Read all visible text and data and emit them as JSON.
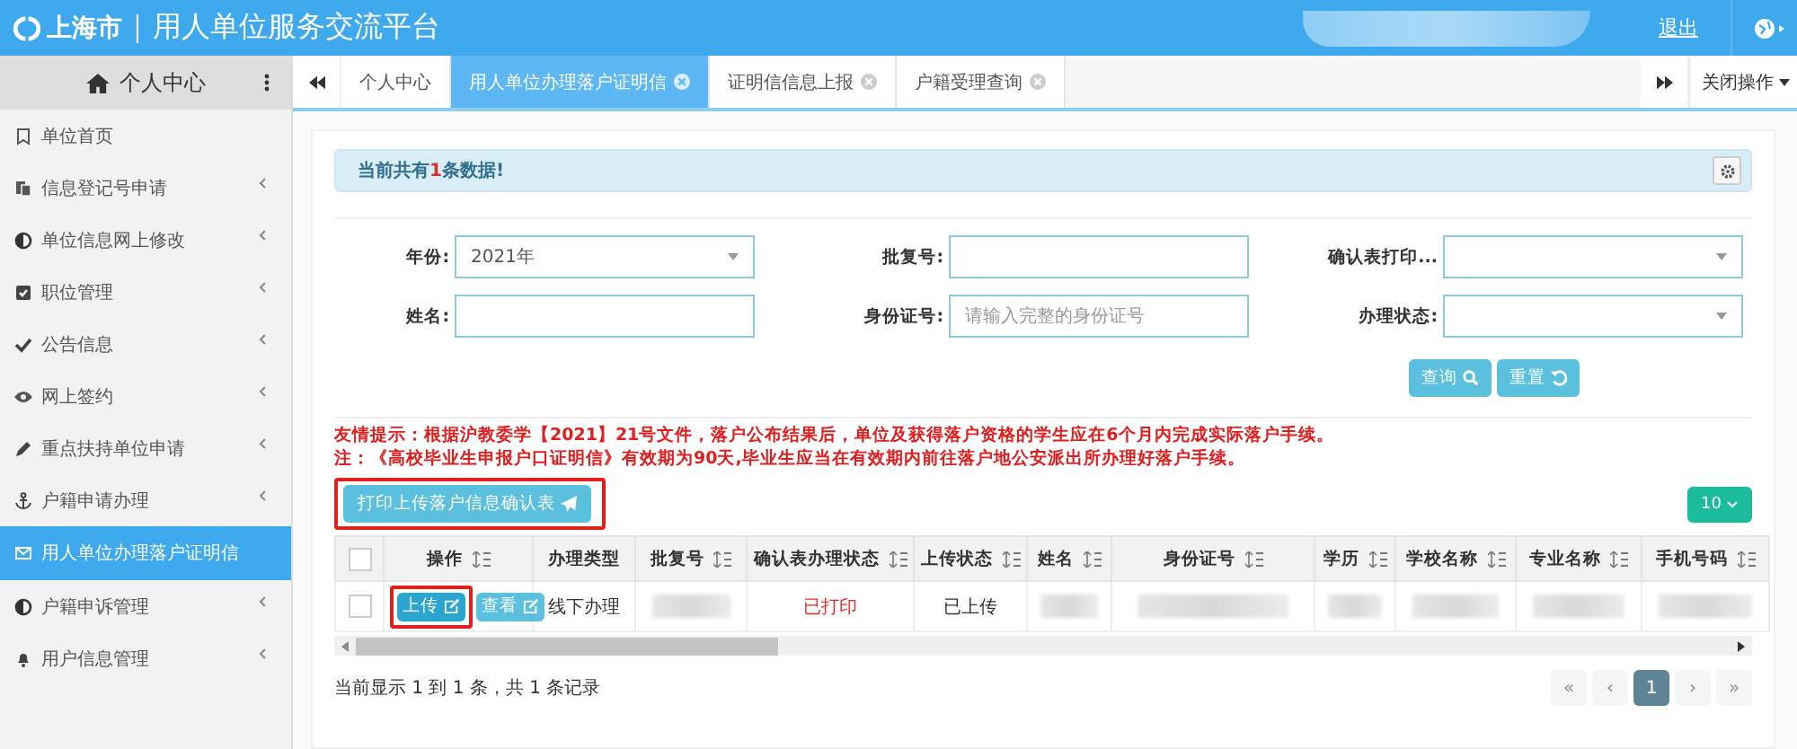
{
  "header": {
    "logo_text": "上海市",
    "title": "用人单位服务交流平台",
    "logout": "退出"
  },
  "sidebar": {
    "title": "个人中心",
    "items": [
      {
        "label": "单位首页",
        "expandable": false,
        "selected": false
      },
      {
        "label": "信息登记号申请",
        "expandable": true,
        "selected": false
      },
      {
        "label": "单位信息网上修改",
        "expandable": true,
        "selected": false
      },
      {
        "label": "职位管理",
        "expandable": true,
        "selected": false
      },
      {
        "label": "公告信息",
        "expandable": true,
        "selected": false
      },
      {
        "label": "网上签约",
        "expandable": true,
        "selected": false
      },
      {
        "label": "重点扶持单位申请",
        "expandable": true,
        "selected": false
      },
      {
        "label": "户籍申请办理",
        "expandable": true,
        "selected": false
      },
      {
        "label": "用人单位办理落户证明信",
        "expandable": false,
        "selected": true
      },
      {
        "label": "户籍申诉管理",
        "expandable": true,
        "selected": false
      },
      {
        "label": "用户信息管理",
        "expandable": true,
        "selected": false
      }
    ]
  },
  "tabs": {
    "items": [
      {
        "label": "个人中心",
        "selected": false,
        "closable": false
      },
      {
        "label": "用人单位办理落户证明信",
        "selected": true,
        "closable": true
      },
      {
        "label": "证明信信息上报",
        "selected": false,
        "closable": true
      },
      {
        "label": "户籍受理查询",
        "selected": false,
        "closable": true
      }
    ],
    "close_menu": "关闭操作"
  },
  "alert": {
    "text": "当前共有**1**条数据!"
  },
  "form": {
    "fields": [
      {
        "label": "年份:",
        "kind": "select",
        "value": "2021年"
      },
      {
        "label": "批复号:",
        "kind": "input"
      },
      {
        "label": "确认表打印...",
        "kind": "select"
      },
      {
        "label": "姓名:",
        "kind": "input"
      },
      {
        "label": "身份证号:",
        "kind": "input",
        "placeholder": "请输入完整的身份证号"
      },
      {
        "label": "办理状态:",
        "kind": "select"
      }
    ],
    "buttons": [
      {
        "label": "查询",
        "kind": "search"
      },
      {
        "label": "重置",
        "kind": "reset"
      }
    ]
  },
  "notices": [
    "友情提示：根据沪教委学【2021】21号文件，落户公布结果后，单位及获得落户资格的学生应在6个月内完成实际落户手续。",
    "注：《高校毕业生申报户口证明信》有效期为90天,毕业生应当在有效期内前往落户地公安派出所办理好落户手续。"
  ],
  "print_button": {
    "label": "打印上传落户信息确认表",
    "highlighted": true
  },
  "page_size": "10",
  "table": {
    "select_all_checked": false,
    "columns": [
      {
        "label": "操作",
        "sortable": true
      },
      {
        "label": "办理类型",
        "sortable": false
      },
      {
        "label": "批复号",
        "sortable": true
      },
      {
        "label": "确认表办理状态",
        "sortable": true
      },
      {
        "label": "上传状态",
        "sortable": true
      },
      {
        "label": "姓名",
        "sortable": true
      },
      {
        "label": "身份证号",
        "sortable": true
      },
      {
        "label": "学历",
        "sortable": true
      },
      {
        "label": "学校名称",
        "sortable": true
      },
      {
        "label": "专业名称",
        "sortable": true
      },
      {
        "label": "手机号码",
        "sortable": true
      }
    ],
    "rows": [
      {
        "checked": false,
        "cells": [
          {
            "kind": "actions",
            "actions": [
              {
                "label": "上传",
                "highlighted": true
              },
              {
                "label": "查看",
                "highlighted": false
              }
            ]
          },
          {
            "kind": "text",
            "text": "线下办理"
          },
          {
            "kind": "blurred"
          },
          {
            "kind": "status",
            "text": "已打印"
          },
          {
            "kind": "text",
            "text": "已上传"
          },
          {
            "kind": "blurred"
          },
          {
            "kind": "blurred"
          },
          {
            "kind": "blurred"
          },
          {
            "kind": "blurred"
          },
          {
            "kind": "blurred"
          },
          {
            "kind": "blurred"
          }
        ]
      }
    ]
  },
  "footer": {
    "summary": "当前显示 1 到 1 条，共 1 条记录",
    "pages": [
      {
        "label": "«",
        "selected": false
      },
      {
        "label": "‹",
        "selected": false
      },
      {
        "label": "1",
        "selected": true
      },
      {
        "label": "›",
        "selected": false
      },
      {
        "label": "»",
        "selected": false
      }
    ]
  }
}
